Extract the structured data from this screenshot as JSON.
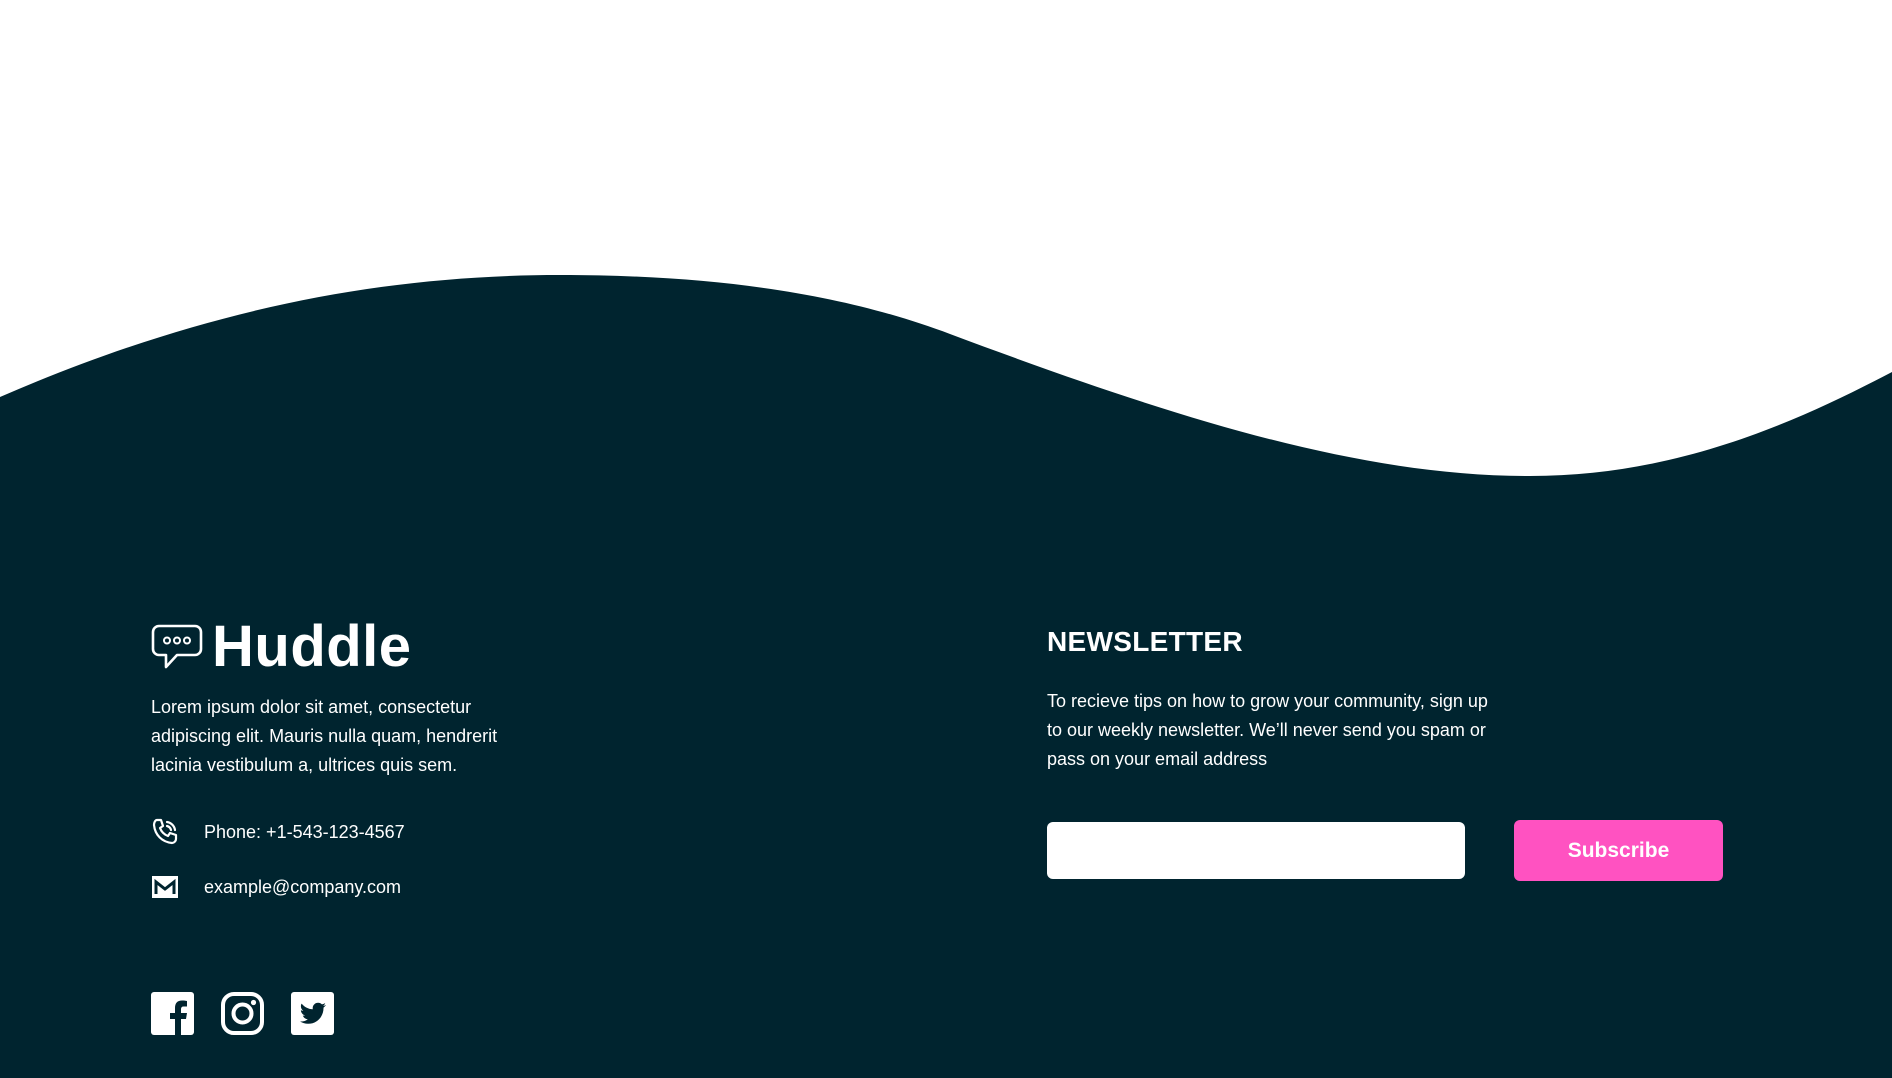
{
  "brand": {
    "name": "Huddle",
    "logo_icon": "chat-bubble-icon"
  },
  "about": {
    "text": "Lorem ipsum dolor sit amet, consectetur adipiscing elit. Mauris nulla quam, hendrerit lacinia vestibulum a, ultrices quis sem."
  },
  "contact": {
    "phone": {
      "icon": "phone-icon",
      "text": "Phone: +1-543-123-4567"
    },
    "email": {
      "icon": "mail-icon",
      "text": "example@company.com"
    }
  },
  "social": [
    {
      "name": "facebook-icon"
    },
    {
      "name": "instagram-icon"
    },
    {
      "name": "twitter-icon"
    }
  ],
  "newsletter": {
    "title": "NEWSLETTER",
    "text": "To recieve tips on how to grow your community, sign up to our weekly newsletter. We’ll never send you spam or pass on your email address",
    "input_value": "",
    "button_label": "Subscribe"
  },
  "colors": {
    "footer_bg": "#00242f",
    "accent": "#ff52c1",
    "text": "#ffffff"
  }
}
